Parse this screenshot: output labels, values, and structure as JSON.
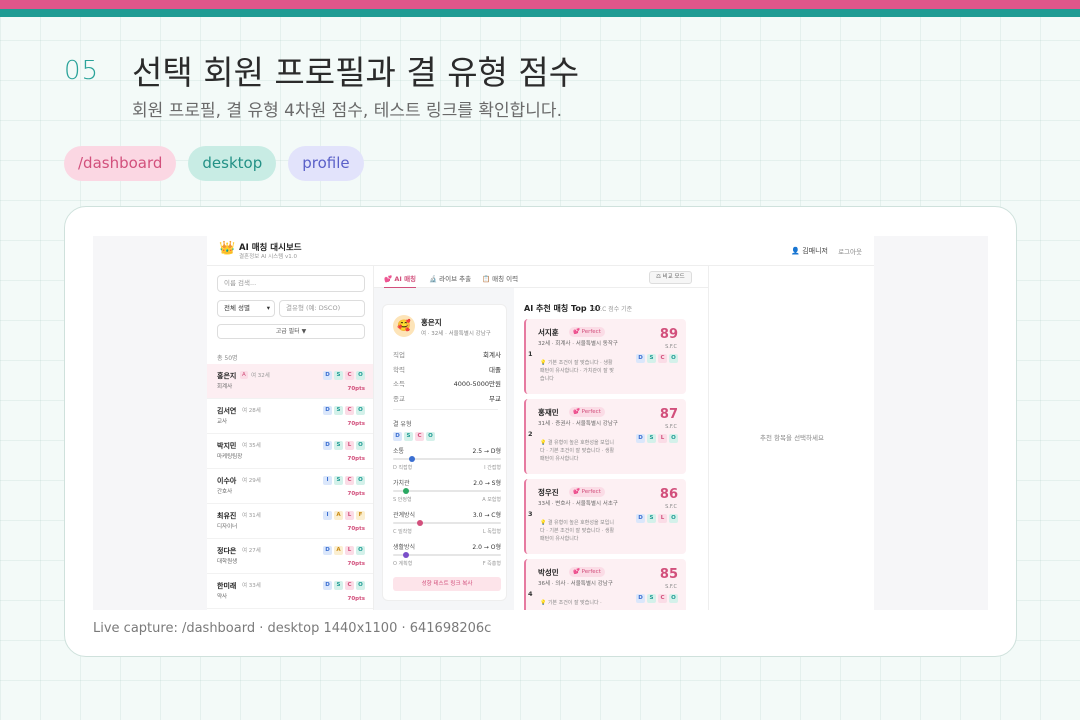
{
  "slide": {
    "number": "05",
    "title": "선택 회원 프로필과 결 유형 점수",
    "subtitle": "회원 프로필, 결 유형 4차원 점수, 테스트 링크를 확인합니다.",
    "tags": [
      "/dashboard",
      "desktop",
      "profile"
    ],
    "caption": "Live capture: /dashboard · desktop 1440x1100 · 641698206c"
  },
  "colors": {
    "accent_pink": "#e0568a",
    "accent_teal": "#1f9c94",
    "score_pink": "#d2507c"
  },
  "app": {
    "logo_icon": "crown-icon",
    "title": "AI 매칭 대시보드",
    "version": "결혼정보 AI 시스템 v1.0",
    "user_icon": "user-icon",
    "user_name": "김매니저",
    "logout": "로그아웃"
  },
  "filters": {
    "search_placeholder": "이름 검색...",
    "gender_select": "전체 성별",
    "type_placeholder": "결유형 (예: DSCO)",
    "advanced_filter": "고급 필터 ▼",
    "total": "총 50명"
  },
  "members": [
    {
      "name": "홍은지",
      "tag": "A",
      "meta": "여 32세",
      "job": "회계사",
      "codes": [
        "D",
        "S",
        "C",
        "O"
      ],
      "pts": "70pts"
    },
    {
      "name": "김서연",
      "meta": "여 28세",
      "job": "교사",
      "codes": [
        "D",
        "S",
        "C",
        "O"
      ],
      "pts": "70pts"
    },
    {
      "name": "박지민",
      "meta": "여 35세",
      "job": "마케팅팀장",
      "codes": [
        "D",
        "S",
        "L",
        "O"
      ],
      "pts": "70pts"
    },
    {
      "name": "이수아",
      "meta": "여 29세",
      "job": "간호사",
      "codes": [
        "I",
        "S",
        "C",
        "O"
      ],
      "pts": "70pts"
    },
    {
      "name": "최유진",
      "meta": "여 31세",
      "job": "디자이너",
      "codes": [
        "I",
        "A",
        "L",
        "F"
      ],
      "pts": "70pts"
    },
    {
      "name": "정다은",
      "meta": "여 27세",
      "job": "대학원생",
      "codes": [
        "D",
        "A",
        "L",
        "O"
      ],
      "pts": "70pts"
    },
    {
      "name": "한미래",
      "meta": "여 33세",
      "job": "약사",
      "codes": [
        "D",
        "S",
        "C",
        "O"
      ],
      "pts": "70pts"
    }
  ],
  "tabs": {
    "ai_match": "💕 AI 매칭",
    "live_extract": "🔬 라이브 추출",
    "history": "📋 매칭 이력",
    "compare": "⚖ 비교 모드"
  },
  "profile": {
    "avatar_icon": "smile-avatar-icon",
    "name": "홍은지",
    "meta": "여 · 32세 · 서울특별시 강남구",
    "rows": [
      {
        "k": "직업",
        "v": "회계사"
      },
      {
        "k": "학력",
        "v": "대졸"
      },
      {
        "k": "소득",
        "v": "4000-5000만원"
      },
      {
        "k": "종교",
        "v": "무교"
      }
    ],
    "section_label": "결 유형",
    "codes": [
      "D",
      "S",
      "C",
      "O"
    ],
    "dims": [
      {
        "label": "소통",
        "value": "2.5 → D형",
        "left": "D 직접형",
        "right": "I 간접형",
        "fraction": 0.18,
        "color": "#3b6fd1"
      },
      {
        "label": "가치관",
        "value": "2.0 → S형",
        "left": "S 안정형",
        "right": "A 모험형",
        "fraction": 0.12,
        "color": "#2aa862"
      },
      {
        "label": "관계방식",
        "value": "3.0 → C형",
        "left": "C 밀착형",
        "right": "L 독립형",
        "fraction": 0.25,
        "color": "#d2507c"
      },
      {
        "label": "생활방식",
        "value": "2.0 → O형",
        "left": "O 계획형",
        "right": "F 즉흥형",
        "fraction": 0.12,
        "color": "#7a4fc9"
      }
    ],
    "copy_link": "성향 테스트 링크 복사"
  },
  "recommend": {
    "title": "AI 추천 매칭 Top 10",
    "subtitle": "S.F.C 점수 기준",
    "unit": "S.F.C",
    "items": [
      {
        "rank": "1",
        "name": "서지훈",
        "badge": "💕 Perfect",
        "meta": "32세 · 회계사 · 서울특별시 동작구",
        "desc": "💡 기본 조건이 잘 맞습니다 · 생활 패턴이 유사합니다 · 가치관이 잘 맞습니다",
        "score": "89",
        "codes": [
          "D",
          "S",
          "C",
          "O"
        ]
      },
      {
        "rank": "2",
        "name": "홍재민",
        "badge": "💕 Perfect",
        "meta": "31세 · 증권사 · 서울특별시 강남구",
        "desc": "💡 결 유형이 높은 호환성을 보입니다 · 기본 조건이 잘 맞습니다 · 생활 패턴이 유사합니다",
        "score": "87",
        "codes": [
          "D",
          "S",
          "L",
          "O"
        ]
      },
      {
        "rank": "3",
        "name": "정우진",
        "badge": "💕 Perfect",
        "meta": "33세 · 변호사 · 서울특별시 서초구",
        "desc": "💡 결 유형이 높은 호환성을 보입니다 · 기본 조건이 잘 맞습니다 · 생활 패턴이 유사합니다",
        "score": "86",
        "codes": [
          "D",
          "S",
          "L",
          "O"
        ]
      },
      {
        "rank": "4",
        "name": "박성민",
        "badge": "💕 Perfect",
        "meta": "36세 · 의사 · 서울특별시 강남구",
        "desc": "💡 기본 조건이 잘 맞습니다 ·",
        "score": "85",
        "codes": [
          "D",
          "S",
          "C",
          "O"
        ]
      }
    ]
  },
  "detail": {
    "empty": "추천 항목을 선택하세요"
  }
}
